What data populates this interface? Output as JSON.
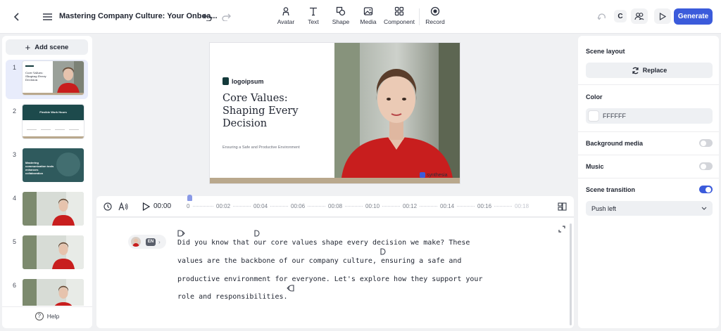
{
  "header": {
    "title": "Mastering Company Culture: Your Onboa...",
    "tools": [
      {
        "label": "Avatar",
        "icon": "avatar-icon"
      },
      {
        "label": "Text",
        "icon": "text-icon"
      },
      {
        "label": "Shape",
        "icon": "shape-icon"
      },
      {
        "label": "Media",
        "icon": "media-icon"
      },
      {
        "label": "Component",
        "icon": "component-icon"
      },
      {
        "label": "Record",
        "icon": "record-icon"
      }
    ],
    "user_initial": "C",
    "generate_label": "Generate"
  },
  "sidebar": {
    "add_scene_label": "Add scene",
    "scenes": [
      {
        "number": "1",
        "active": true
      },
      {
        "number": "2",
        "active": false
      },
      {
        "number": "3",
        "active": false
      },
      {
        "number": "4",
        "active": false
      },
      {
        "number": "5",
        "active": false
      },
      {
        "number": "6",
        "active": false
      }
    ],
    "help_label": "Help"
  },
  "thumbs": {
    "s1_title": "Core Values: Shaping Every Decision",
    "s2_title": "Flexible Work Hours",
    "s3_title": "Mastering communication tools enhances collaboration"
  },
  "slide": {
    "logo": "logoipsum",
    "title": "Core Values: Shaping Every Decision",
    "subtitle": "Ensuring a Safe and Productive Environment",
    "watermark": "synthesia"
  },
  "timeline": {
    "current_time": "00:00",
    "ticks": [
      "0",
      "00:02",
      "00:04",
      "00:06",
      "00:08",
      "00:10",
      "00:12",
      "00:14",
      "00:16",
      "00:18"
    ]
  },
  "script": {
    "language": "EN",
    "lines": [
      "Did you know that our core values shape every decision we make? These",
      "values are the backbone of our company culture, ensuring a safe and",
      "productive environment for everyone. Let's explore how they support your",
      "role and responsibilities."
    ]
  },
  "settings": {
    "scene_layout_label": "Scene layout",
    "replace_label": "Replace",
    "color_label": "Color",
    "color_value": "FFFFFF",
    "background_media_label": "Background media",
    "background_media_on": false,
    "music_label": "Music",
    "music_on": false,
    "scene_transition_label": "Scene transition",
    "scene_transition_on": true,
    "transition_value": "Push left"
  },
  "colors": {
    "accent": "#3b5bdb",
    "slide_band": "#b9a88d",
    "shirt_red": "#c81e1e"
  }
}
